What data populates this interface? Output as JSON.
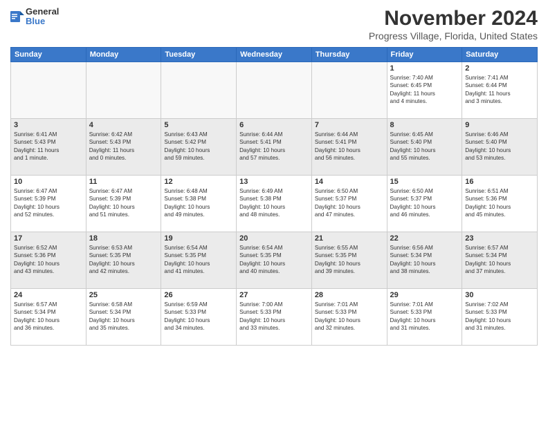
{
  "logo": {
    "general": "General",
    "blue": "Blue"
  },
  "header": {
    "month": "November 2024",
    "location": "Progress Village, Florida, United States"
  },
  "weekdays": [
    "Sunday",
    "Monday",
    "Tuesday",
    "Wednesday",
    "Thursday",
    "Friday",
    "Saturday"
  ],
  "weeks": [
    [
      {
        "day": "",
        "info": ""
      },
      {
        "day": "",
        "info": ""
      },
      {
        "day": "",
        "info": ""
      },
      {
        "day": "",
        "info": ""
      },
      {
        "day": "",
        "info": ""
      },
      {
        "day": "1",
        "info": "Sunrise: 7:40 AM\nSunset: 6:45 PM\nDaylight: 11 hours\nand 4 minutes."
      },
      {
        "day": "2",
        "info": "Sunrise: 7:41 AM\nSunset: 6:44 PM\nDaylight: 11 hours\nand 3 minutes."
      }
    ],
    [
      {
        "day": "3",
        "info": "Sunrise: 6:41 AM\nSunset: 5:43 PM\nDaylight: 11 hours\nand 1 minute."
      },
      {
        "day": "4",
        "info": "Sunrise: 6:42 AM\nSunset: 5:43 PM\nDaylight: 11 hours\nand 0 minutes."
      },
      {
        "day": "5",
        "info": "Sunrise: 6:43 AM\nSunset: 5:42 PM\nDaylight: 10 hours\nand 59 minutes."
      },
      {
        "day": "6",
        "info": "Sunrise: 6:44 AM\nSunset: 5:41 PM\nDaylight: 10 hours\nand 57 minutes."
      },
      {
        "day": "7",
        "info": "Sunrise: 6:44 AM\nSunset: 5:41 PM\nDaylight: 10 hours\nand 56 minutes."
      },
      {
        "day": "8",
        "info": "Sunrise: 6:45 AM\nSunset: 5:40 PM\nDaylight: 10 hours\nand 55 minutes."
      },
      {
        "day": "9",
        "info": "Sunrise: 6:46 AM\nSunset: 5:40 PM\nDaylight: 10 hours\nand 53 minutes."
      }
    ],
    [
      {
        "day": "10",
        "info": "Sunrise: 6:47 AM\nSunset: 5:39 PM\nDaylight: 10 hours\nand 52 minutes."
      },
      {
        "day": "11",
        "info": "Sunrise: 6:47 AM\nSunset: 5:39 PM\nDaylight: 10 hours\nand 51 minutes."
      },
      {
        "day": "12",
        "info": "Sunrise: 6:48 AM\nSunset: 5:38 PM\nDaylight: 10 hours\nand 49 minutes."
      },
      {
        "day": "13",
        "info": "Sunrise: 6:49 AM\nSunset: 5:38 PM\nDaylight: 10 hours\nand 48 minutes."
      },
      {
        "day": "14",
        "info": "Sunrise: 6:50 AM\nSunset: 5:37 PM\nDaylight: 10 hours\nand 47 minutes."
      },
      {
        "day": "15",
        "info": "Sunrise: 6:50 AM\nSunset: 5:37 PM\nDaylight: 10 hours\nand 46 minutes."
      },
      {
        "day": "16",
        "info": "Sunrise: 6:51 AM\nSunset: 5:36 PM\nDaylight: 10 hours\nand 45 minutes."
      }
    ],
    [
      {
        "day": "17",
        "info": "Sunrise: 6:52 AM\nSunset: 5:36 PM\nDaylight: 10 hours\nand 43 minutes."
      },
      {
        "day": "18",
        "info": "Sunrise: 6:53 AM\nSunset: 5:35 PM\nDaylight: 10 hours\nand 42 minutes."
      },
      {
        "day": "19",
        "info": "Sunrise: 6:54 AM\nSunset: 5:35 PM\nDaylight: 10 hours\nand 41 minutes."
      },
      {
        "day": "20",
        "info": "Sunrise: 6:54 AM\nSunset: 5:35 PM\nDaylight: 10 hours\nand 40 minutes."
      },
      {
        "day": "21",
        "info": "Sunrise: 6:55 AM\nSunset: 5:35 PM\nDaylight: 10 hours\nand 39 minutes."
      },
      {
        "day": "22",
        "info": "Sunrise: 6:56 AM\nSunset: 5:34 PM\nDaylight: 10 hours\nand 38 minutes."
      },
      {
        "day": "23",
        "info": "Sunrise: 6:57 AM\nSunset: 5:34 PM\nDaylight: 10 hours\nand 37 minutes."
      }
    ],
    [
      {
        "day": "24",
        "info": "Sunrise: 6:57 AM\nSunset: 5:34 PM\nDaylight: 10 hours\nand 36 minutes."
      },
      {
        "day": "25",
        "info": "Sunrise: 6:58 AM\nSunset: 5:34 PM\nDaylight: 10 hours\nand 35 minutes."
      },
      {
        "day": "26",
        "info": "Sunrise: 6:59 AM\nSunset: 5:33 PM\nDaylight: 10 hours\nand 34 minutes."
      },
      {
        "day": "27",
        "info": "Sunrise: 7:00 AM\nSunset: 5:33 PM\nDaylight: 10 hours\nand 33 minutes."
      },
      {
        "day": "28",
        "info": "Sunrise: 7:01 AM\nSunset: 5:33 PM\nDaylight: 10 hours\nand 32 minutes."
      },
      {
        "day": "29",
        "info": "Sunrise: 7:01 AM\nSunset: 5:33 PM\nDaylight: 10 hours\nand 31 minutes."
      },
      {
        "day": "30",
        "info": "Sunrise: 7:02 AM\nSunset: 5:33 PM\nDaylight: 10 hours\nand 31 minutes."
      }
    ]
  ]
}
